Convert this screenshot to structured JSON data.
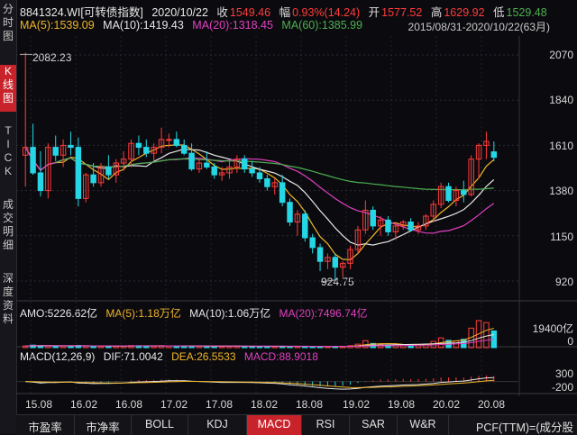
{
  "colors": {
    "up": "#ff3b3b",
    "down": "#25d6e6",
    "ma5": "#f0b429",
    "ma10": "#e6e6e6",
    "ma20": "#e040c0",
    "ma60": "#4caf50",
    "bg": "#0b0b0f"
  },
  "sidebar": [
    {
      "label": "分时图",
      "active": false
    },
    {
      "label": "K线图",
      "active": true
    },
    {
      "label": "TICK",
      "active": false
    },
    {
      "label": "成交明细",
      "active": false
    },
    {
      "label": "深度资料",
      "active": false
    }
  ],
  "header": {
    "code": "8841324.WI[可转债指数]",
    "date": "2020/10/22",
    "close_label": "收",
    "close": "1549.46",
    "change_label": "幅",
    "change": "0.93%(14.24)",
    "open_label": "开",
    "open": "1577.52",
    "high_label": "高",
    "high": "1629.92",
    "low_label": "低",
    "low": "1529.48"
  },
  "ma": {
    "ma5": "MA(5):1539.09",
    "ma10": "MA(10):1419.43",
    "ma20": "MA(20):1318.45",
    "ma60": "MA(60):1385.99",
    "range": "2015/08/31-2020/10/22(63月)"
  },
  "price_axis": [
    "2070",
    "1840",
    "1610",
    "1380",
    "1150",
    "920"
  ],
  "annotations": {
    "high": "2082.23",
    "low": "924.75"
  },
  "amo": {
    "amo": "AMO:5226.62亿",
    "ma5": "MA(5):1.18万亿",
    "ma10": "MA(10):1.06万亿",
    "ma20": "MA(20):7496.74亿"
  },
  "vol_axis": [
    "19400亿",
    "0"
  ],
  "macd": {
    "name": "MACD(12,26,9)",
    "dif": "DIF:71.0042",
    "dea": "DEA:26.5533",
    "macd": "MACD:88.9018"
  },
  "macd_axis": [
    "300",
    "-200"
  ],
  "dates": [
    "15.08",
    "16.02",
    "16.08",
    "17.02",
    "17.08",
    "18.02",
    "18.08",
    "19.02",
    "19.08",
    "20.02",
    "20.08"
  ],
  "bottom_tabs": [
    {
      "label": "市盈率",
      "active": false
    },
    {
      "label": "市净率",
      "active": false
    },
    {
      "label": "BOLL",
      "active": false
    },
    {
      "label": "KDJ",
      "active": false
    },
    {
      "label": "MACD",
      "active": true
    },
    {
      "label": "RSI",
      "active": false
    },
    {
      "label": "SAR",
      "active": false
    },
    {
      "label": "W&R",
      "active": false
    }
  ],
  "bottom_right": "PCF(TTM)=(成分股",
  "chart_data": {
    "type": "candlestick",
    "period": "monthly",
    "y_axis": [
      920,
      2070
    ],
    "candles": [
      {
        "o": 1560,
        "h": 2082,
        "l": 1400,
        "c": 1600
      },
      {
        "o": 1600,
        "h": 1720,
        "l": 1460,
        "c": 1470
      },
      {
        "o": 1470,
        "h": 1580,
        "l": 1350,
        "c": 1380
      },
      {
        "o": 1380,
        "h": 1620,
        "l": 1340,
        "c": 1600
      },
      {
        "o": 1600,
        "h": 1660,
        "l": 1530,
        "c": 1560
      },
      {
        "o": 1560,
        "h": 1640,
        "l": 1500,
        "c": 1610
      },
      {
        "o": 1610,
        "h": 1680,
        "l": 1560,
        "c": 1600
      },
      {
        "o": 1600,
        "h": 1650,
        "l": 1300,
        "c": 1340
      },
      {
        "o": 1340,
        "h": 1470,
        "l": 1320,
        "c": 1460
      },
      {
        "o": 1460,
        "h": 1520,
        "l": 1400,
        "c": 1420
      },
      {
        "o": 1420,
        "h": 1520,
        "l": 1400,
        "c": 1500
      },
      {
        "o": 1500,
        "h": 1560,
        "l": 1440,
        "c": 1460
      },
      {
        "o": 1460,
        "h": 1540,
        "l": 1420,
        "c": 1520
      },
      {
        "o": 1520,
        "h": 1580,
        "l": 1480,
        "c": 1540
      },
      {
        "o": 1540,
        "h": 1640,
        "l": 1500,
        "c": 1620
      },
      {
        "o": 1620,
        "h": 1660,
        "l": 1560,
        "c": 1600
      },
      {
        "o": 1600,
        "h": 1640,
        "l": 1550,
        "c": 1570
      },
      {
        "o": 1570,
        "h": 1620,
        "l": 1530,
        "c": 1600
      },
      {
        "o": 1600,
        "h": 1700,
        "l": 1570,
        "c": 1640
      },
      {
        "o": 1640,
        "h": 1670,
        "l": 1600,
        "c": 1640
      },
      {
        "o": 1640,
        "h": 1680,
        "l": 1600,
        "c": 1610
      },
      {
        "o": 1610,
        "h": 1640,
        "l": 1560,
        "c": 1570
      },
      {
        "o": 1570,
        "h": 1620,
        "l": 1480,
        "c": 1490
      },
      {
        "o": 1490,
        "h": 1540,
        "l": 1470,
        "c": 1520
      },
      {
        "o": 1520,
        "h": 1580,
        "l": 1490,
        "c": 1500
      },
      {
        "o": 1500,
        "h": 1520,
        "l": 1440,
        "c": 1460
      },
      {
        "o": 1460,
        "h": 1500,
        "l": 1430,
        "c": 1470
      },
      {
        "o": 1470,
        "h": 1530,
        "l": 1440,
        "c": 1500
      },
      {
        "o": 1500,
        "h": 1560,
        "l": 1470,
        "c": 1540
      },
      {
        "o": 1540,
        "h": 1560,
        "l": 1470,
        "c": 1490
      },
      {
        "o": 1490,
        "h": 1530,
        "l": 1450,
        "c": 1470
      },
      {
        "o": 1470,
        "h": 1500,
        "l": 1420,
        "c": 1440
      },
      {
        "o": 1440,
        "h": 1460,
        "l": 1380,
        "c": 1400
      },
      {
        "o": 1400,
        "h": 1440,
        "l": 1360,
        "c": 1420
      },
      {
        "o": 1420,
        "h": 1460,
        "l": 1300,
        "c": 1320
      },
      {
        "o": 1320,
        "h": 1340,
        "l": 1200,
        "c": 1220
      },
      {
        "o": 1220,
        "h": 1280,
        "l": 1150,
        "c": 1260
      },
      {
        "o": 1260,
        "h": 1280,
        "l": 1120,
        "c": 1140
      },
      {
        "o": 1140,
        "h": 1160,
        "l": 1060,
        "c": 1090
      },
      {
        "o": 1090,
        "h": 1110,
        "l": 970,
        "c": 1020
      },
      {
        "o": 1020,
        "h": 1060,
        "l": 980,
        "c": 1040
      },
      {
        "o": 1040,
        "h": 1060,
        "l": 925,
        "c": 990
      },
      {
        "o": 990,
        "h": 1020,
        "l": 940,
        "c": 1010
      },
      {
        "o": 1010,
        "h": 1100,
        "l": 980,
        "c": 1080
      },
      {
        "o": 1080,
        "h": 1200,
        "l": 1060,
        "c": 1180
      },
      {
        "o": 1180,
        "h": 1330,
        "l": 1160,
        "c": 1280
      },
      {
        "o": 1280,
        "h": 1300,
        "l": 1180,
        "c": 1200
      },
      {
        "o": 1200,
        "h": 1250,
        "l": 1150,
        "c": 1230
      },
      {
        "o": 1230,
        "h": 1250,
        "l": 1150,
        "c": 1170
      },
      {
        "o": 1170,
        "h": 1220,
        "l": 1130,
        "c": 1200
      },
      {
        "o": 1200,
        "h": 1230,
        "l": 1180,
        "c": 1220
      },
      {
        "o": 1220,
        "h": 1240,
        "l": 1170,
        "c": 1180
      },
      {
        "o": 1180,
        "h": 1220,
        "l": 1160,
        "c": 1200
      },
      {
        "o": 1200,
        "h": 1260,
        "l": 1180,
        "c": 1250
      },
      {
        "o": 1250,
        "h": 1330,
        "l": 1220,
        "c": 1310
      },
      {
        "o": 1310,
        "h": 1420,
        "l": 1290,
        "c": 1400
      },
      {
        "o": 1400,
        "h": 1420,
        "l": 1320,
        "c": 1330
      },
      {
        "o": 1330,
        "h": 1400,
        "l": 1300,
        "c": 1380
      },
      {
        "o": 1380,
        "h": 1430,
        "l": 1320,
        "c": 1360
      },
      {
        "o": 1360,
        "h": 1560,
        "l": 1350,
        "c": 1540
      },
      {
        "o": 1540,
        "h": 1620,
        "l": 1440,
        "c": 1610
      },
      {
        "o": 1610,
        "h": 1680,
        "l": 1540,
        "c": 1630
      },
      {
        "o": 1577,
        "h": 1630,
        "l": 1529,
        "c": 1549
      }
    ],
    "volume_max": 19400,
    "volume": [
      1200,
      1800,
      1400,
      1300,
      1100,
      1200,
      1300,
      1600,
      1200,
      1100,
      1000,
      1100,
      1200,
      1300,
      1500,
      1400,
      1300,
      1200,
      1400,
      1300,
      1200,
      1100,
      1000,
      1100,
      1100,
      1000,
      900,
      1000,
      1100,
      1000,
      900,
      900,
      800,
      900,
      1000,
      900,
      1000,
      900,
      900,
      800,
      900,
      900,
      1000,
      1400,
      2500,
      5000,
      3000,
      2200,
      2000,
      2100,
      2200,
      2000,
      2100,
      2600,
      4500,
      7000,
      5200,
      4800,
      6000,
      14000,
      19400,
      18000,
      12000
    ],
    "series": [
      {
        "name": "MA(5)"
      },
      {
        "name": "MA(10)"
      },
      {
        "name": "MA(20)"
      },
      {
        "name": "MA(60)"
      }
    ]
  }
}
